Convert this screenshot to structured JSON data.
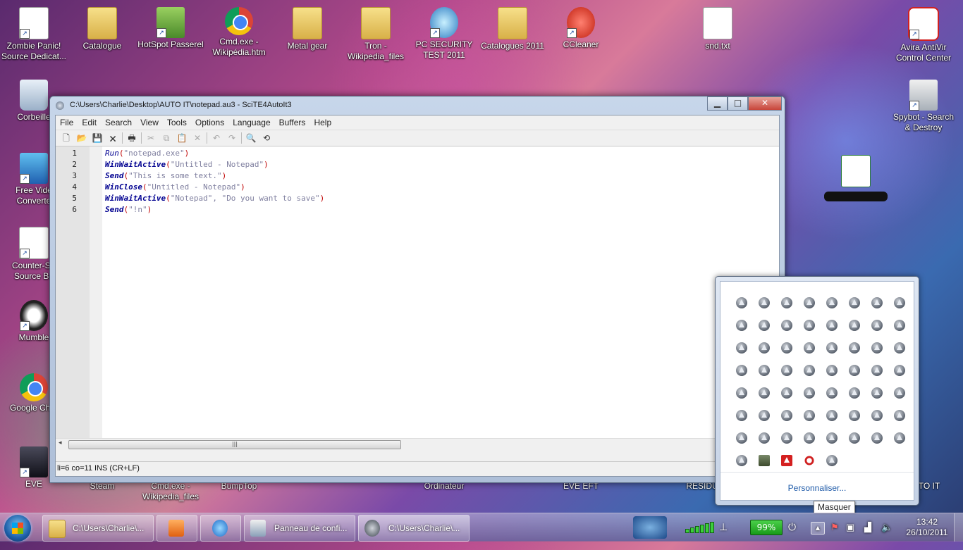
{
  "desktop": {
    "icons": [
      {
        "label": "Zombie Panic!\nSource Dedicat...",
        "kind": "doc"
      },
      {
        "label": "Catalogue",
        "kind": "folder"
      },
      {
        "label": "HotSpot Passerel",
        "kind": "image"
      },
      {
        "label": "Cmd.exe -\nWikipédia.htm",
        "kind": "chrome"
      },
      {
        "label": "Metal gear",
        "kind": "folder"
      },
      {
        "label": "Tron -\nWikipedia_files",
        "kind": "folder"
      },
      {
        "label": "PC SECURITY\nTEST 2011",
        "kind": "app"
      },
      {
        "label": "Catalogues 2011",
        "kind": "folder"
      },
      {
        "label": "CCleaner",
        "kind": "app"
      },
      {
        "label": "snd.txt",
        "kind": "doc"
      },
      {
        "label": "Avira AntiVir\nControl Center",
        "kind": "app"
      },
      {
        "label": "Corbeille",
        "kind": "bin"
      },
      {
        "label": "Spybot - Search\n& Destroy",
        "kind": "app"
      },
      {
        "label": "Free Vide\nConverte",
        "kind": "app"
      },
      {
        "label": "Counter-Str\nSource Be",
        "kind": "doc"
      },
      {
        "label": "Mumble",
        "kind": "app"
      },
      {
        "label": "Google Chro",
        "kind": "chrome"
      },
      {
        "label": "EVE",
        "kind": "app"
      },
      {
        "label": "Steam",
        "kind": "app"
      },
      {
        "label": "Cmd.exe -\nWikipedia_files",
        "kind": "folder"
      },
      {
        "label": "BumpTop",
        "kind": "app"
      },
      {
        "label": "Ordinateur",
        "kind": "app"
      },
      {
        "label": "EVE EFT",
        "kind": "app"
      },
      {
        "label": "RESIDU",
        "kind": "folder"
      },
      {
        "label": "TO IT",
        "kind": "folder"
      }
    ]
  },
  "window": {
    "title": "C:\\Users\\Charlie\\Desktop\\AUTO IT\\notepad.au3 - SciTE4AutoIt3",
    "menu": [
      "File",
      "Edit",
      "Search",
      "View",
      "Tools",
      "Options",
      "Language",
      "Buffers",
      "Help"
    ],
    "status": "li=6 co=11 INS (CR+LF)",
    "scroll_thumb": "|||"
  },
  "code": {
    "lines": [
      {
        "n": "1",
        "fn": "Run",
        "bold": false,
        "open": "(",
        "args": "\"notepad.exe\"",
        "close": ")"
      },
      {
        "n": "2",
        "fn": "WinWaitActive",
        "bold": true,
        "open": "(",
        "args": "\"Untitled - Notepad\"",
        "close": ")"
      },
      {
        "n": "3",
        "fn": "Send",
        "bold": true,
        "open": "(",
        "args": "\"This is some text.\"",
        "close": ")"
      },
      {
        "n": "4",
        "fn": "WinClose",
        "bold": true,
        "open": "(",
        "args": "\"Untitled - Notepad\"",
        "close": ")"
      },
      {
        "n": "5",
        "fn": "WinWaitActive",
        "bold": true,
        "open": "(",
        "args": "\"Notepad\", \"Do you want to save\"",
        "close": ")"
      },
      {
        "n": "6",
        "fn": "Send",
        "bold": true,
        "open": "(",
        "args": "\"!n\"",
        "close": ")"
      }
    ]
  },
  "tray": {
    "customize": "Personnaliser...",
    "tooltip": "Masquer"
  },
  "taskbar": {
    "buttons": [
      {
        "label": "C:\\Users\\Charlie\\...",
        "kind": "folder"
      },
      {
        "label": "",
        "kind": "media"
      },
      {
        "label": "",
        "kind": "ie"
      },
      {
        "label": "Panneau de confi...",
        "kind": "control-panel"
      },
      {
        "label": "C:\\Users\\Charlie\\...",
        "kind": "autoit"
      }
    ],
    "battery": "99%",
    "time": "13:42",
    "date": "26/10/2011"
  }
}
